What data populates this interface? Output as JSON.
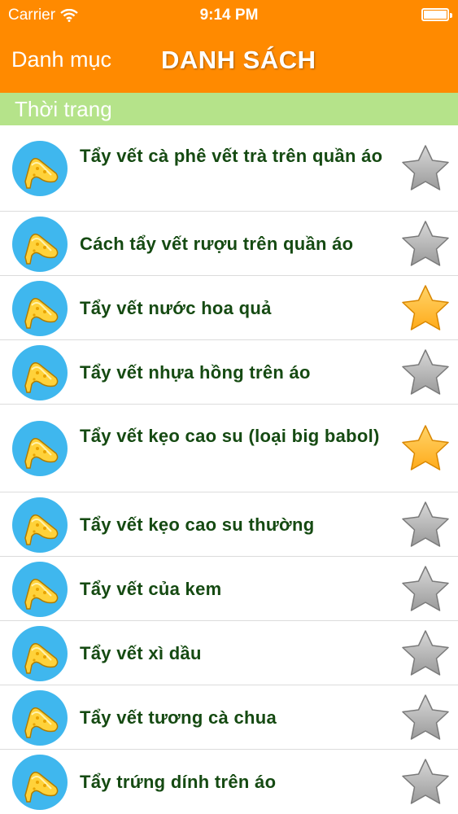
{
  "status_bar": {
    "carrier": "Carrier",
    "time": "9:14 PM"
  },
  "nav": {
    "back_label": "Danh mục",
    "title": "DANH SÁCH"
  },
  "section": {
    "title": "Thời trang"
  },
  "colors": {
    "nav_bg": "#ff8a00",
    "section_bg": "#b5e38a",
    "item_text": "#154a12",
    "avatar_bg": "#3fb7ee",
    "star_on": "#ffab1a",
    "star_off": "#9a9a9a"
  },
  "items": [
    {
      "label": "Tẩy vết cà phê vết trà trên quần áo",
      "favorite": false,
      "icon": "high-heel-shoe-icon"
    },
    {
      "label": "Cách tẩy vết rượu trên quần áo",
      "favorite": false,
      "icon": "high-heel-shoe-icon"
    },
    {
      "label": "Tẩy vết nước hoa quả",
      "favorite": true,
      "icon": "high-heel-shoe-icon"
    },
    {
      "label": "Tẩy vết nhựa hồng trên áo",
      "favorite": false,
      "icon": "high-heel-shoe-icon"
    },
    {
      "label": "Tẩy vết kẹo cao su (loại big babol)",
      "favorite": true,
      "icon": "high-heel-shoe-icon"
    },
    {
      "label": "Tẩy vết kẹo cao su thường",
      "favorite": false,
      "icon": "high-heel-shoe-icon"
    },
    {
      "label": "Tẩy vết của kem",
      "favorite": false,
      "icon": "high-heel-shoe-icon"
    },
    {
      "label": "Tẩy vết xì dầu",
      "favorite": false,
      "icon": "high-heel-shoe-icon"
    },
    {
      "label": "Tẩy vết tương cà chua",
      "favorite": false,
      "icon": "high-heel-shoe-icon"
    },
    {
      "label": "Tẩy trứng dính trên áo",
      "favorite": false,
      "icon": "high-heel-shoe-icon"
    }
  ]
}
